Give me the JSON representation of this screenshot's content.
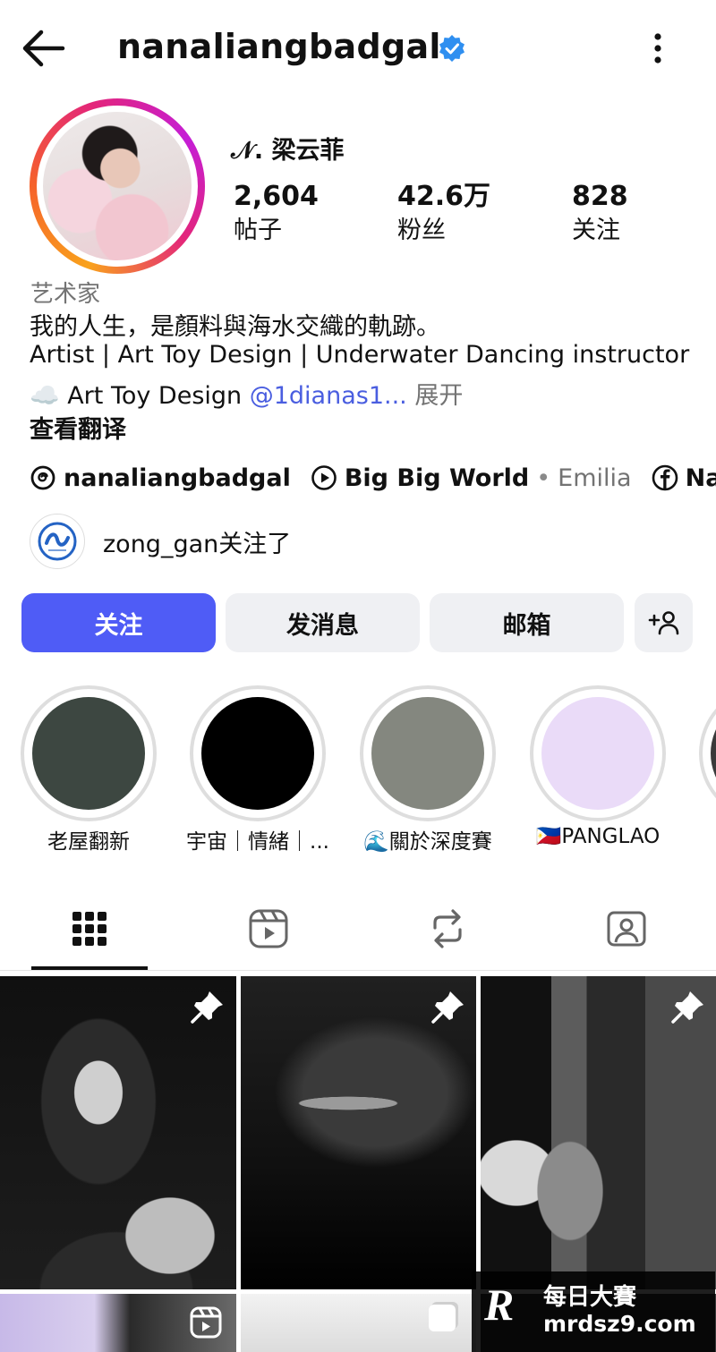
{
  "header": {
    "username": "nanaliangbadgal"
  },
  "profile": {
    "display_name": "𝒩. 梁云菲",
    "stats": [
      {
        "value": "2,604",
        "label": "帖子"
      },
      {
        "value": "42.6万",
        "label": "粉丝"
      },
      {
        "value": "828",
        "label": "关注"
      }
    ]
  },
  "bio": {
    "category": "艺术家",
    "line1": "我的人生，是顏料與海水交織的軌跡。",
    "line2": "Artist | Art Toy Design  | Underwater Dancing instructor",
    "line3_prefix": "☁️ Art Toy Design ",
    "line3_mention": "@1dianas1...",
    "line3_more": "展开",
    "translate": "查看翻译"
  },
  "links": {
    "threads": "nanaliangbadgal",
    "music_title": "Big Big World",
    "music_artist": "Emilia",
    "facebook": "Na..."
  },
  "followed_by": {
    "text": "zong_gan关注了"
  },
  "buttons": {
    "follow": "关注",
    "message": "发消息",
    "email": "邮箱"
  },
  "highlights": [
    {
      "label": "老屋翻新",
      "color": "#3d4741"
    },
    {
      "label": "宇宙｜情緒｜...",
      "color": "#000000"
    },
    {
      "label": "🌊關於深度賽",
      "color": "#84877f"
    },
    {
      "label": "🇵🇭PANGLAO",
      "color": "#eadbf8"
    }
  ],
  "watermark": {
    "logo": "R",
    "cn": "每日大賽",
    "url": "mrdsz9.com"
  }
}
